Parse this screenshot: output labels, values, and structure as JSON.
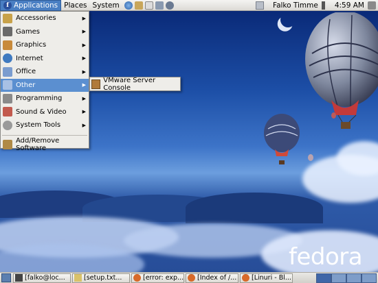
{
  "top_panel": {
    "menus": [
      "Applications",
      "Places",
      "System"
    ],
    "user": "Falko Timme",
    "time": "4:59 AM",
    "launchers": [
      "browser-icon",
      "mail-icon",
      "notes-icon",
      "gear-icon",
      "network-icon"
    ]
  },
  "app_menu": {
    "items": [
      {
        "label": "Accessories",
        "icon": "accessories-icon",
        "color": "#c8a24a",
        "submenu": true
      },
      {
        "label": "Games",
        "icon": "games-icon",
        "color": "#6a6a6a",
        "submenu": true
      },
      {
        "label": "Graphics",
        "icon": "graphics-icon",
        "color": "#c88a3a",
        "submenu": true
      },
      {
        "label": "Internet",
        "icon": "internet-icon",
        "color": "#3f7ac0",
        "submenu": true
      },
      {
        "label": "Office",
        "icon": "office-icon",
        "color": "#7a9ccf",
        "submenu": true
      },
      {
        "label": "Other",
        "icon": "folder-icon",
        "color": "#a8c0e4",
        "submenu": true,
        "selected": true
      },
      {
        "label": "Programming",
        "icon": "programming-icon",
        "color": "#8a8a8a",
        "submenu": true
      },
      {
        "label": "Sound & Video",
        "icon": "sound-video-icon",
        "color": "#c25a4e",
        "submenu": true
      },
      {
        "label": "System Tools",
        "icon": "system-tools-icon",
        "color": "#9a9a9a",
        "submenu": true
      }
    ],
    "footer_item": {
      "label": "Add/Remove Software",
      "icon": "add-remove-software-icon",
      "color": "#b08a46"
    }
  },
  "sub_menu": {
    "item": {
      "label": "VMware Server Console",
      "icon": "vmware-icon",
      "color": "#b07a3a"
    }
  },
  "taskbar": {
    "tasks": [
      {
        "label": "[falko@loc...",
        "icon": "terminal-icon",
        "color": "#444444"
      },
      {
        "label": "[setup.txt...",
        "icon": "text-editor-icon",
        "color": "#d9c26a"
      },
      {
        "label": "[error: exp...",
        "icon": "firefox-icon",
        "color": "#d86a2a"
      },
      {
        "label": "[Index of /...",
        "icon": "firefox-icon",
        "color": "#d86a2a"
      },
      {
        "label": "[Linuri - Bl...",
        "icon": "firefox-icon",
        "color": "#d86a2a"
      }
    ]
  },
  "desktop": {
    "brand": "fedora"
  },
  "colors": {
    "selection": "#5b8fd0",
    "panel": "#dcdad5"
  }
}
